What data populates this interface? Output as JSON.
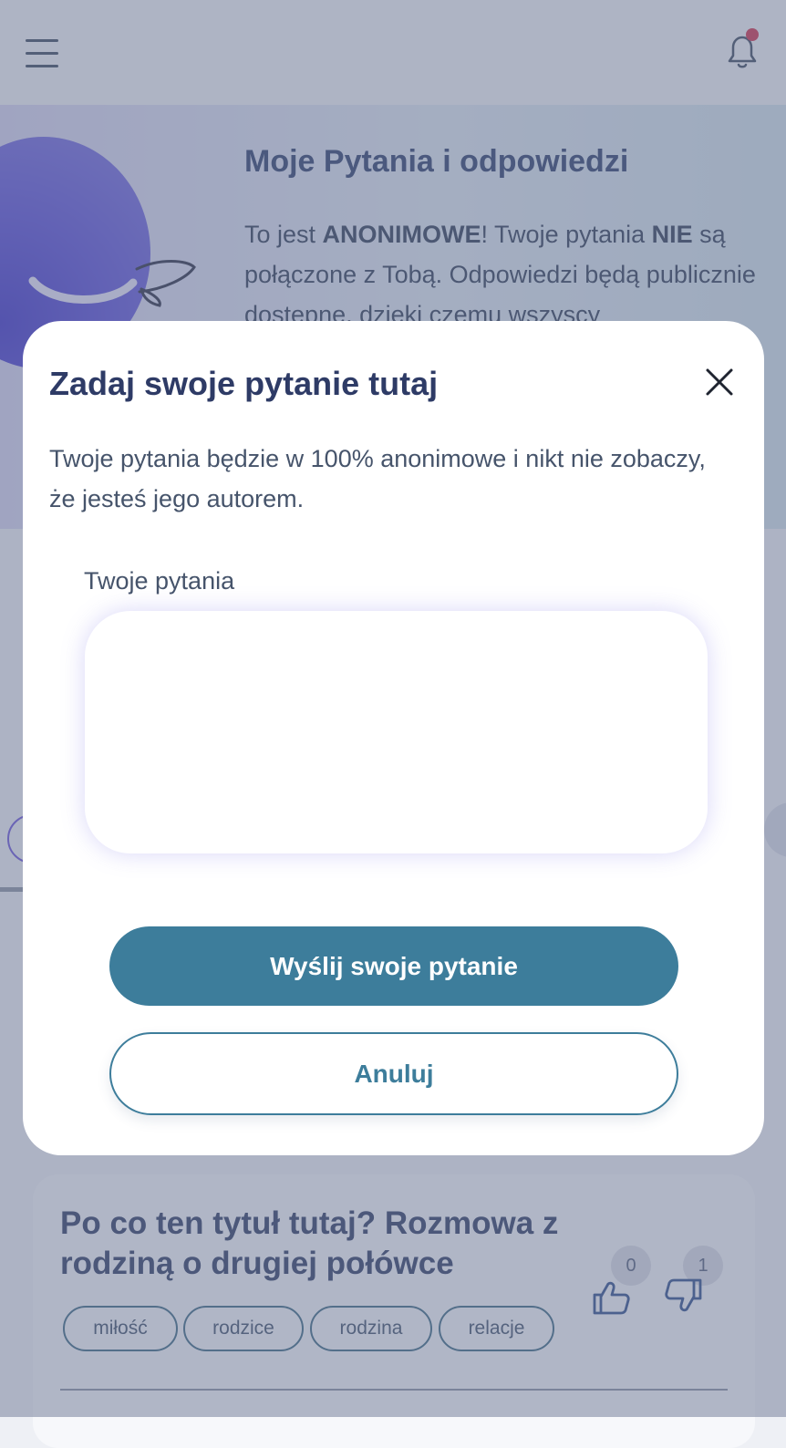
{
  "header": {
    "menu_icon": "hamburger-menu-icon",
    "notification_icon": "bell-icon",
    "notification_dot_color": "#d0314a"
  },
  "hero": {
    "title": "Moje Pytania i odpowiedzi",
    "text_part1": "To jest ",
    "text_bold1": "ANONIMOWE",
    "text_part2": "! Twoje pytania ",
    "text_bold2": "NIE",
    "text_part3": " są połączone z Tobą. Odpowiedzi będą publicznie dostępne, dzięki czemu wszyscy"
  },
  "modal": {
    "title": "Zadaj swoje pytanie tutaj",
    "description": "Twoje pytania będzie w 100% anonimowe i nikt nie zobaczy, że jesteś jego autorem.",
    "field_label": "Twoje pytania",
    "field_value": "",
    "submit_label": "Wyślij swoje pytanie",
    "cancel_label": "Anuluj",
    "accent_color": "#3d7d9b"
  },
  "post": {
    "title": "Po co ten tytuł tutaj? Rozmowa z rodziną o drugiej połówce",
    "tags": [
      "miłość",
      "rodzice",
      "rodzina",
      "relacje"
    ],
    "likes": "0",
    "dislikes": "1"
  }
}
